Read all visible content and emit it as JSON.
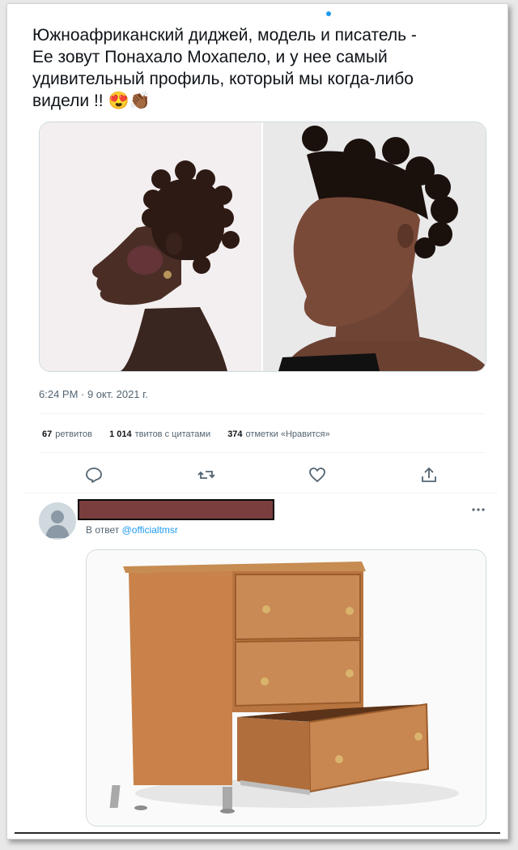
{
  "tweet": {
    "text_line1": "Южноафриканский диджей, модель и писатель -",
    "text_line2": "Ее зовут Понахало Мохапело, и у нее самый",
    "text_line3": "удивительный профиль, который мы когда-либо",
    "text_line4": "видели !! 😍👏🏾",
    "timestamp": "6:24 PM · 9 окт. 2021 г.",
    "retweets_count": "67",
    "retweets_label": "ретвитов",
    "quotes_count": "1 014",
    "quotes_label": "твитов с цитатами",
    "likes_count": "374",
    "likes_label": "отметки «Нравится»"
  },
  "reply": {
    "replying_prefix": "В ответ",
    "replying_handle": "@officialtmsr",
    "more_label": "···"
  },
  "icons": {
    "reply": "reply-icon",
    "retweet": "retweet-icon",
    "like": "heart-icon",
    "share": "share-icon",
    "avatar": "default-avatar-icon",
    "more": "more-icon"
  },
  "colors": {
    "accent": "#1d9bf0",
    "text": "#0f1419",
    "secondary": "#536471",
    "redaction": "#7a3e3e"
  }
}
